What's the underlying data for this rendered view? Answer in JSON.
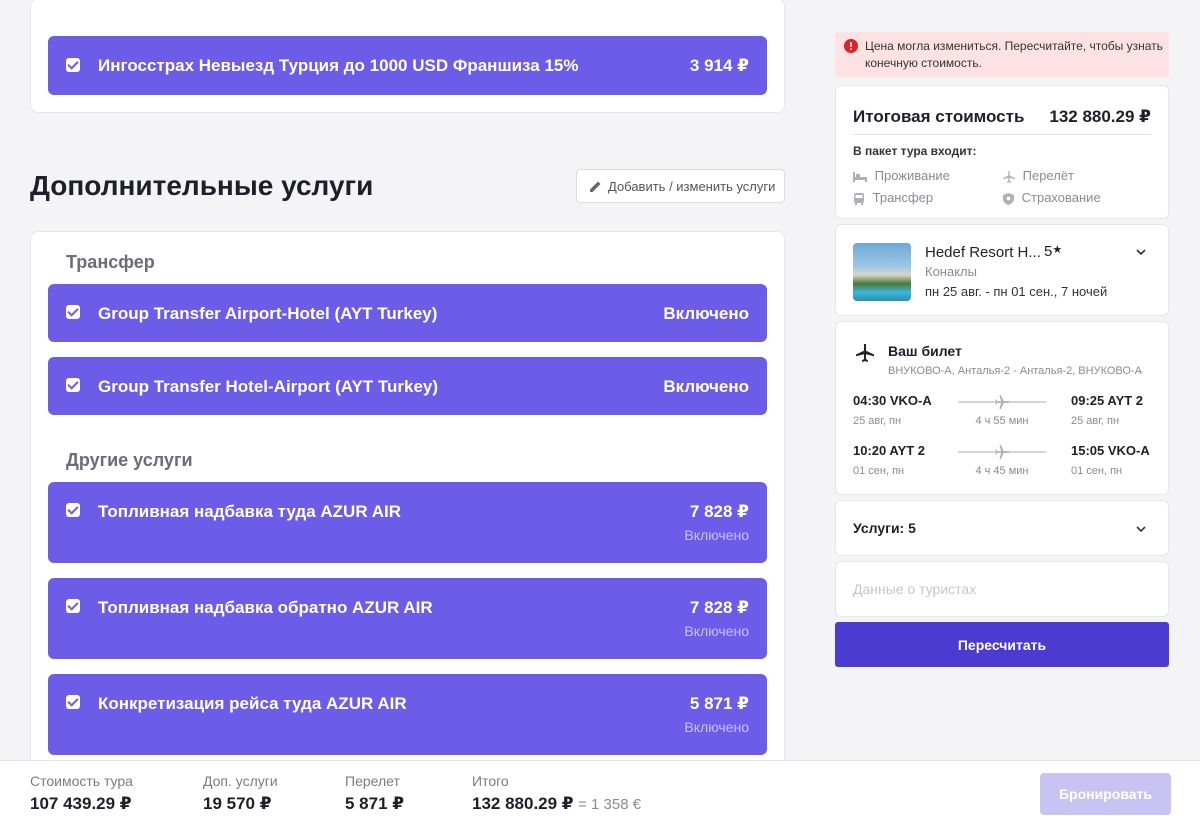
{
  "insurance": {
    "name": "Ингосстрах Невыезд Турция до 1000 USD Франшиза 15%",
    "price": "3 914 ₽"
  },
  "extras": {
    "title": "Дополнительные услуги",
    "edit_button": "Добавить / изменить услуги",
    "transfer_title": "Трансфер",
    "transfers": [
      {
        "name": "Group Transfer Airport-Hotel (AYT Turkey)",
        "status": "Включено"
      },
      {
        "name": "Group Transfer Hotel-Airport (AYT Turkey)",
        "status": "Включено"
      }
    ],
    "other_title": "Другие услуги",
    "others": [
      {
        "name": "Топливная надбавка туда AZUR AIR",
        "price": "7 828 ₽",
        "status": "Включено"
      },
      {
        "name": "Топливная надбавка обратно AZUR AIR",
        "price": "7 828 ₽",
        "status": "Включено"
      },
      {
        "name": "Конкретизация рейса туда AZUR AIR",
        "price": "5 871 ₽",
        "status": "Включено"
      }
    ]
  },
  "alert": {
    "text": "Цена могла измениться. Пересчитайте, чтобы узнать конечную стоимость."
  },
  "summary": {
    "title": "Итоговая стоимость",
    "total": "132 880.29 ₽",
    "includes_label": "В пакет тура входит:",
    "items": {
      "stay": "Проживание",
      "flight": "Перелёт",
      "transfer": "Трансфер",
      "insurance": "Страхование"
    }
  },
  "hotel": {
    "name": "Hedef Resort H...",
    "stars": "5",
    "location": "Конаклы",
    "dates": "пн 25 авг. - пн 01 сен., 7 ночей"
  },
  "ticket": {
    "title": "Ваш билет",
    "route": "ВНУКОВО-А, Анталья-2 - Анталья-2, ВНУКОВО-А",
    "legs": [
      {
        "dep_time": "04:30 VKO-A",
        "dep_date": "25 авг, пн",
        "duration": "4 ч 55 мин",
        "arr_time": "09:25 AYT 2",
        "arr_date": "25 авг, пн"
      },
      {
        "dep_time": "10:20 AYT 2",
        "dep_date": "01 сен, пн",
        "duration": "4 ч 45 мин",
        "arr_time": "15:05 VKO-A",
        "arr_date": "01 сен, пн"
      }
    ]
  },
  "services": {
    "label": "Услуги: 5"
  },
  "tourists": {
    "label": "Данные о туристах"
  },
  "recalc_button": "Пересчитать",
  "footer": {
    "tour_label": "Стоимость тура",
    "tour_value": "107 439.29 ₽",
    "extras_label": "Доп. услуги",
    "extras_value": "19 570 ₽",
    "flight_label": "Перелет",
    "flight_value": "5 871 ₽",
    "total_label": "Итого",
    "total_value": "132 880.29 ₽",
    "total_eur": "= 1 358 €",
    "book_button": "Бронировать"
  },
  "colors": {
    "accent": "#6c5ce7",
    "button": "#4c3bd1",
    "alert_bg": "#fde2e4",
    "alert_icon": "#e0202a",
    "book_disabled": "#c9c3f3"
  }
}
